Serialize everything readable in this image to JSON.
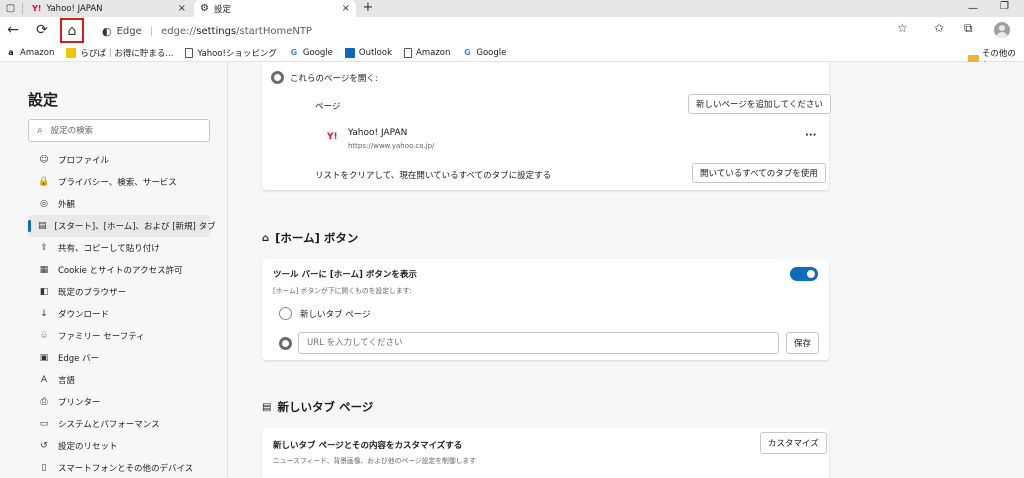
{
  "tabs": [
    {
      "title": "Yahoo! JAPAN",
      "icon": "yahoo-favicon"
    },
    {
      "title": "設定",
      "icon": "gear-icon",
      "active": true
    }
  ],
  "toolbar": {
    "back": "←",
    "refresh": "⟳",
    "home": "⌂",
    "edge_label": "Edge",
    "url_prefix": "edge://",
    "url_main": "settings",
    "url_suffix": "/startHomeNTP"
  },
  "favorites": [
    {
      "label": "Amazon",
      "icon": "amazon-icon",
      "glyph": "a"
    },
    {
      "label": "らぴぱ｜お得に貯まる...",
      "icon": "rapipa-icon",
      "glyph": ""
    },
    {
      "label": "Yahoo!ショッピング",
      "icon": "page-icon",
      "glyph": ""
    },
    {
      "label": "Google",
      "icon": "google-icon",
      "glyph": "G"
    },
    {
      "label": "Outlook",
      "icon": "outlook-icon",
      "glyph": ""
    },
    {
      "label": "Amazon",
      "icon": "page-icon",
      "glyph": ""
    },
    {
      "label": "Google",
      "icon": "google-icon",
      "glyph": "G"
    }
  ],
  "favorites_other": "その他のお",
  "sidebar": {
    "title": "設定",
    "search_placeholder": "設定の検索",
    "items": [
      {
        "label": "プロファイル",
        "glyph": "☺"
      },
      {
        "label": "プライバシー、検索、サービス",
        "glyph": "🔒"
      },
      {
        "label": "外観",
        "glyph": "◎"
      },
      {
        "label": "[スタート]、[ホーム]、および [新規] タブ",
        "glyph": "▤",
        "selected": true
      },
      {
        "label": "共有、コピーして貼り付け",
        "glyph": "⇪"
      },
      {
        "label": "Cookie とサイトのアクセス許可",
        "glyph": "▦"
      },
      {
        "label": "既定のブラウザー",
        "glyph": "◧"
      },
      {
        "label": "ダウンロード",
        "glyph": "↓"
      },
      {
        "label": "ファミリー セーフティ",
        "glyph": "♧"
      },
      {
        "label": "Edge バー",
        "glyph": "▣"
      },
      {
        "label": "言語",
        "glyph": "A"
      },
      {
        "label": "プリンター",
        "glyph": "⎙"
      },
      {
        "label": "システムとパフォーマンス",
        "glyph": "▭"
      },
      {
        "label": "設定のリセット",
        "glyph": "↺"
      },
      {
        "label": "スマートフォンとその他のデバイス",
        "glyph": "▯"
      }
    ]
  },
  "startup_card": {
    "open_pages_label": "これらのページを開く:",
    "pages_label": "ページ",
    "add_page_button": "新しいページを追加してください",
    "site_name": "Yahoo! JAPAN",
    "site_url": "https://www.yahoo.co.jp/",
    "more": "···",
    "clear_label": "リストをクリアして、現在開いているすべてのタブに設定する",
    "use_all_tabs_button": "開いているすべてのタブを使用"
  },
  "home_section": {
    "title": "[ホーム] ボタン",
    "toggle_label": "ツール バーに [ホーム] ボタンを表示",
    "toggle_sub": "[ホーム] ボタンが下に開くものを設定します:",
    "toggle_on": true,
    "new_tab_option": "新しいタブ ページ",
    "url_placeholder": "URL を入力してください",
    "save_button": "保存"
  },
  "ntp_section": {
    "title": "新しいタブ ページ",
    "customize_label": "新しいタブ ページとその内容をカスタマイズする",
    "customize_sub": "ニュースフィード、背景画像、および他のページ設定を制御します",
    "customize_button": "カスタマイズ"
  },
  "colors": {
    "accent": "#0f6cbd",
    "highlight_box": "#e01818",
    "yahoo_red": "#ff0033"
  }
}
